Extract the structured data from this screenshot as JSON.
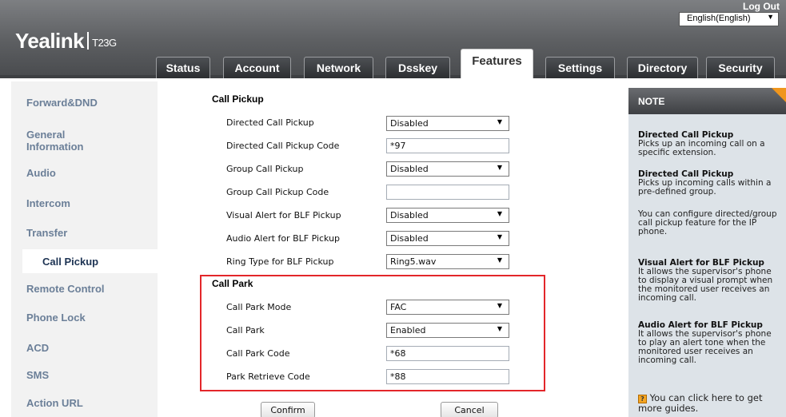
{
  "header": {
    "brand": "Yealink",
    "model": "T23G",
    "logout": "Log Out",
    "language": "English(English)"
  },
  "tabs": [
    {
      "label": "Status"
    },
    {
      "label": "Account"
    },
    {
      "label": "Network"
    },
    {
      "label": "Dsskey"
    },
    {
      "label": "Features",
      "active": true
    },
    {
      "label": "Settings"
    },
    {
      "label": "Directory"
    },
    {
      "label": "Security"
    }
  ],
  "sidebar": {
    "items": [
      {
        "label": "Forward&DND"
      },
      {
        "label": "General\nInformation"
      },
      {
        "label": "Audio"
      },
      {
        "label": "Intercom"
      },
      {
        "label": "Transfer"
      },
      {
        "label": "Call Pickup",
        "active": true
      },
      {
        "label": "Remote Control"
      },
      {
        "label": "Phone Lock"
      },
      {
        "label": "ACD"
      },
      {
        "label": "SMS"
      },
      {
        "label": "Action URL"
      }
    ]
  },
  "call_pickup": {
    "title": "Call Pickup",
    "rows": [
      {
        "label": "Directed Call Pickup",
        "value": "Disabled",
        "type": "select"
      },
      {
        "label": "Directed Call Pickup Code",
        "value": "*97",
        "type": "input"
      },
      {
        "label": "Group Call Pickup",
        "value": "Disabled",
        "type": "select"
      },
      {
        "label": "Group Call Pickup Code",
        "value": "",
        "type": "input"
      },
      {
        "label": "Visual Alert for BLF Pickup",
        "value": "Disabled",
        "type": "select"
      },
      {
        "label": "Audio Alert for BLF Pickup",
        "value": "Disabled",
        "type": "select"
      },
      {
        "label": "Ring Type for BLF Pickup",
        "value": "Ring5.wav",
        "type": "select"
      }
    ]
  },
  "call_park": {
    "title": "Call Park",
    "rows": [
      {
        "label": "Call Park Mode",
        "value": "FAC",
        "type": "select"
      },
      {
        "label": "Call Park",
        "value": "Enabled",
        "type": "select"
      },
      {
        "label": "Call Park Code",
        "value": "*68",
        "type": "input"
      },
      {
        "label": "Park Retrieve Code",
        "value": "*88",
        "type": "input"
      }
    ]
  },
  "buttons": {
    "confirm": "Confirm",
    "cancel": "Cancel"
  },
  "note": {
    "title": "NOTE",
    "sections": [
      {
        "heading": "Directed Call Pickup",
        "body": "Picks up an incoming call on a specific extension."
      },
      {
        "heading": "Directed Call Pickup",
        "body": "Picks up incoming calls within a pre-defined group."
      },
      {
        "heading": "",
        "body": "You can configure directed/group call pickup feature for the IP phone."
      },
      {
        "heading": "Visual Alert for BLF Pickup",
        "body": "It allows the supervisor's phone to display a visual prompt when the monitored user receives an incoming call."
      },
      {
        "heading": "Audio Alert for BLF Pickup",
        "body": "It allows the supervisor's phone to play an alert tone when the monitored user receives an incoming call."
      }
    ],
    "help_text": "You can click here to get more guides.",
    "help_icon": "?"
  },
  "colors": {
    "highlight": "#e3262a",
    "note_corner": "#f0961d",
    "sidebar_text": "#6b7f98",
    "sidebar_active": "#1d3353"
  }
}
